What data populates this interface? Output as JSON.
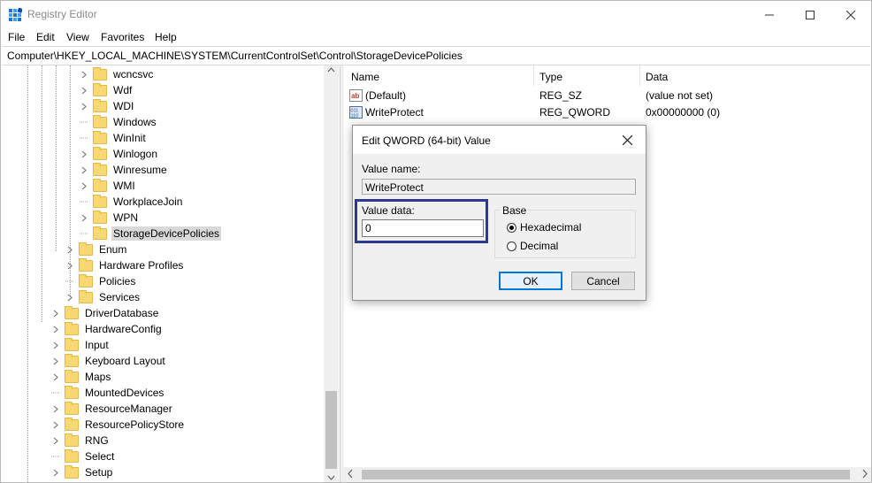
{
  "window": {
    "title": "Registry Editor"
  },
  "menu": [
    "File",
    "Edit",
    "View",
    "Favorites",
    "Help"
  ],
  "address": "Computer\\HKEY_LOCAL_MACHINE\\SYSTEM\\CurrentControlSet\\Control\\StorageDevicePolicies",
  "tree": {
    "items": [
      {
        "label": "wcncsvc",
        "expandable": true
      },
      {
        "label": "Wdf",
        "expandable": true
      },
      {
        "label": "WDI",
        "expandable": true
      },
      {
        "label": "Windows",
        "expandable": false
      },
      {
        "label": "WinInit",
        "expandable": false
      },
      {
        "label": "Winlogon",
        "expandable": true
      },
      {
        "label": "Winresume",
        "expandable": true
      },
      {
        "label": "WMI",
        "expandable": true
      },
      {
        "label": "WorkplaceJoin",
        "expandable": false
      },
      {
        "label": "WPN",
        "expandable": true
      },
      {
        "label": "StorageDevicePolicies",
        "expandable": false,
        "selected": true
      },
      {
        "label": "Enum",
        "expandable": true
      },
      {
        "label": "Hardware Profiles",
        "expandable": true
      },
      {
        "label": "Policies",
        "expandable": false
      },
      {
        "label": "Services",
        "expandable": true
      },
      {
        "label": "DriverDatabase",
        "expandable": true
      },
      {
        "label": "HardwareConfig",
        "expandable": true
      },
      {
        "label": "Input",
        "expandable": true
      },
      {
        "label": "Keyboard Layout",
        "expandable": true
      },
      {
        "label": "Maps",
        "expandable": true
      },
      {
        "label": "MountedDevices",
        "expandable": false
      },
      {
        "label": "ResourceManager",
        "expandable": true
      },
      {
        "label": "ResourcePolicyStore",
        "expandable": true
      },
      {
        "label": "RNG",
        "expandable": true
      },
      {
        "label": "Select",
        "expandable": false
      },
      {
        "label": "Setup",
        "expandable": true
      }
    ]
  },
  "list": {
    "columns": [
      "Name",
      "Type",
      "Data"
    ],
    "rows": [
      {
        "name": "(Default)",
        "type": "REG_SZ",
        "data": "(value not set)",
        "icon": "string-value-icon"
      },
      {
        "name": "WriteProtect",
        "type": "REG_QWORD",
        "data": "0x00000000 (0)",
        "icon": "binary-value-icon"
      }
    ]
  },
  "dialog": {
    "title": "Edit QWORD (64-bit) Value",
    "value_name_label": "Value name:",
    "value_name": "WriteProtect",
    "value_data_label": "Value data:",
    "value_data": "0",
    "base_label": "Base",
    "base_options": [
      "Hexadecimal",
      "Decimal"
    ],
    "base_selected": "Hexadecimal",
    "ok_label": "OK",
    "cancel_label": "Cancel"
  },
  "colors": {
    "highlight_border": "#2e3a8c",
    "ok_border": "#0078d7",
    "folder": "#f8d775",
    "selected_row": "#d9d9d9"
  }
}
